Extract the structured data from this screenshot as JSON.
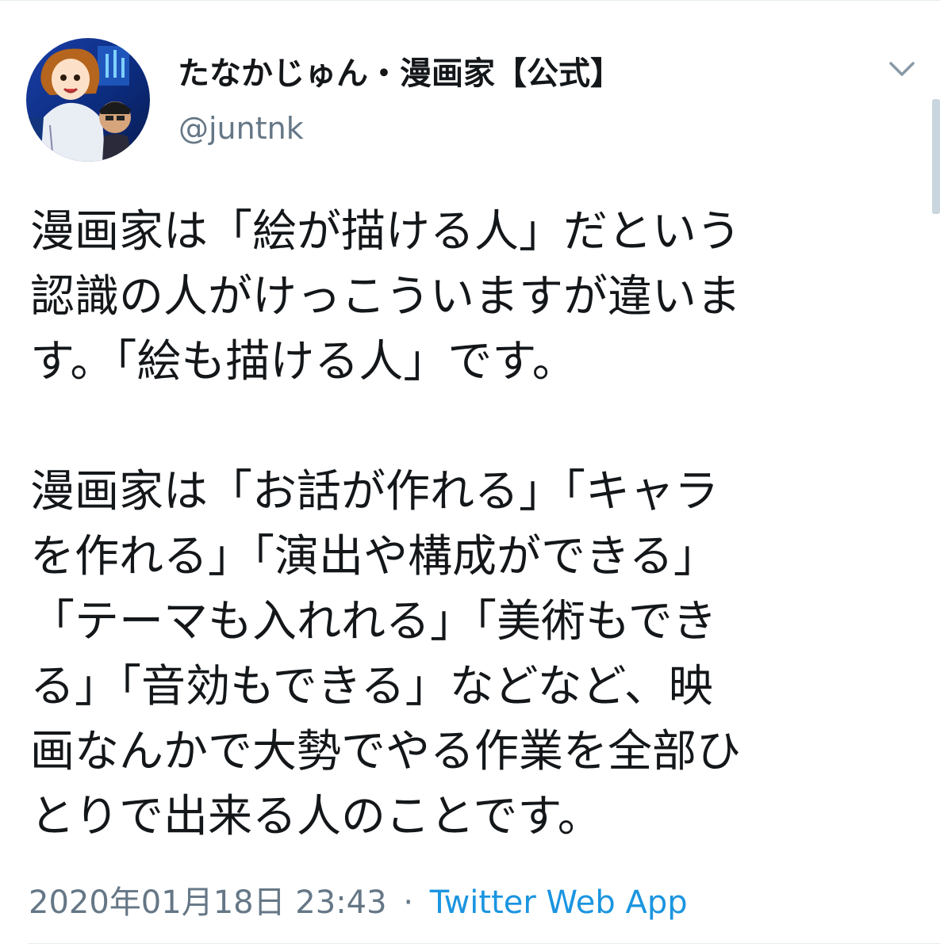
{
  "user": {
    "display_name": "たなかじゅん・漫画家【公式】",
    "handle": "@juntnk",
    "avatar_icon": "profile-avatar-illustration"
  },
  "menu_icon": "chevron-down-icon",
  "tweet": {
    "paragraph1": [
      "漫画家は「絵が描ける人」だという",
      "認識の人がけっこういますが違いま",
      "す。「絵も描ける人」です。"
    ],
    "paragraph2": [
      "漫画家は「お話が作れる」「キャラ",
      "を作れる」「演出や構成ができる」",
      "「テーマも入れれる」「美術もでき",
      "る」「音効もできる」などなど、映",
      "画なんかで大勢でやる作業を全部ひ",
      "とりで出来る人のことです。"
    ]
  },
  "meta": {
    "timestamp": "2020年01月18日 23:43",
    "separator": "·",
    "source": "Twitter Web App"
  },
  "colors": {
    "text": "#14171a",
    "secondary": "#657786",
    "link": "#1b95e0",
    "border": "#e6ecf0"
  }
}
